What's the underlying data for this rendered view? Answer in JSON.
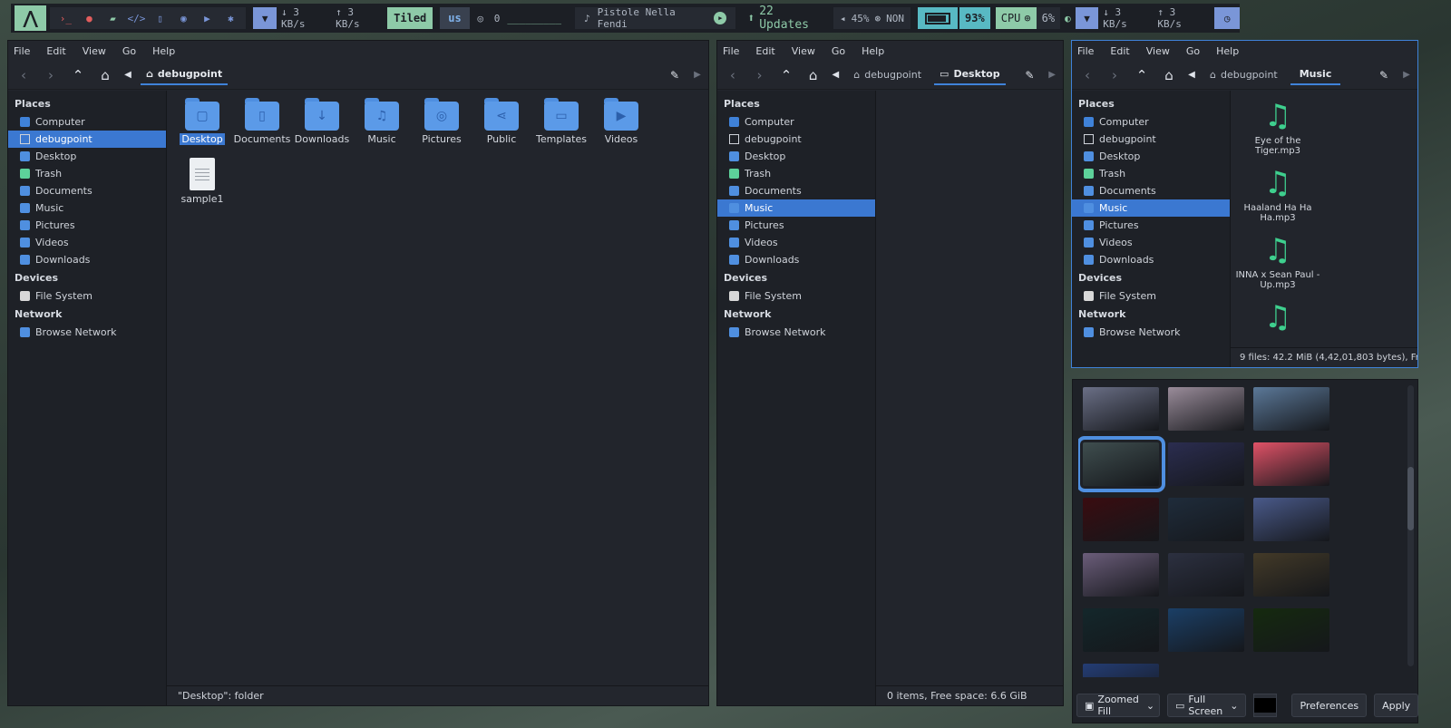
{
  "topbar": {
    "net_down": "3 KB/s",
    "net_up": "3 KB/s",
    "layout": "Tiled",
    "keyboard": "us",
    "github_count": "0",
    "github_bar": "_________",
    "now_playing": "Pistole Nella Fendi",
    "updates": "22 Updates",
    "volume": "45%",
    "mic": "NON",
    "battery": "93%",
    "battery_level": 0.93,
    "cpu_label": "CPU",
    "cpu": "6%",
    "net2_down": "3 KB/s",
    "net2_up": "3 KB/s",
    "icons": [
      "arch-icon",
      "terminal-icon",
      "firefox-icon",
      "files-icon",
      "code-icon",
      "phone-icon",
      "chat-icon",
      "youtube-icon",
      "settings-icon",
      "wifi-icon",
      "github-icon",
      "music-note-icon",
      "play-icon",
      "update-icon",
      "volume-icon",
      "mic-icon",
      "battery-icon",
      "cpu-icon",
      "brightness-icon",
      "clock-icon"
    ]
  },
  "menu": {
    "file": "File",
    "edit": "Edit",
    "view": "View",
    "go": "Go",
    "help": "Help"
  },
  "sidebar": {
    "places": "Places",
    "devices": "Devices",
    "network": "Network",
    "computer": "Computer",
    "home": "debugpoint",
    "desktop": "Desktop",
    "trash": "Trash",
    "documents": "Documents",
    "music": "Music",
    "pictures": "Pictures",
    "videos": "Videos",
    "downloads": "Downloads",
    "filesystem": "File System",
    "browse": "Browse Network"
  },
  "win1": {
    "crumb": "debugpoint",
    "files": [
      "Desktop",
      "Documents",
      "Downloads",
      "Music",
      "Pictures",
      "Public",
      "Templates",
      "Videos",
      "sample1"
    ],
    "status": "\"Desktop\": folder"
  },
  "win2": {
    "crumb1": "debugpoint",
    "crumb2": "Desktop",
    "status": "0 items, Free space: 6.6 GiB"
  },
  "win3": {
    "crumb1": "debugpoint",
    "crumb2": "Music",
    "songs": [
      "Eye of the Tiger.mp3",
      "Haaland Ha Ha Ha.mp3",
      "INNA x Sean Paul - Up.mp3",
      ""
    ],
    "status": "9 files: 42.2 MiB (4,42,01,803 bytes), Fr..."
  },
  "wallpaper": {
    "mode": "Zoomed Fill",
    "span": "Full Screen",
    "preferences": "Preferences",
    "apply": "Apply",
    "thumb_colors": [
      "#6a6f86",
      "#9a8c9a",
      "#5b7898",
      "#3f4e4f",
      "#2b2d50",
      "#e05267",
      "#3a0c10",
      "#1f2c3b",
      "#4a5a8a",
      "#6b5d7a",
      "#2c3040",
      "#433a28",
      "#14272b",
      "#1b3f66",
      "#152a0f",
      "#243d74"
    ],
    "selected_color": "#000000"
  }
}
